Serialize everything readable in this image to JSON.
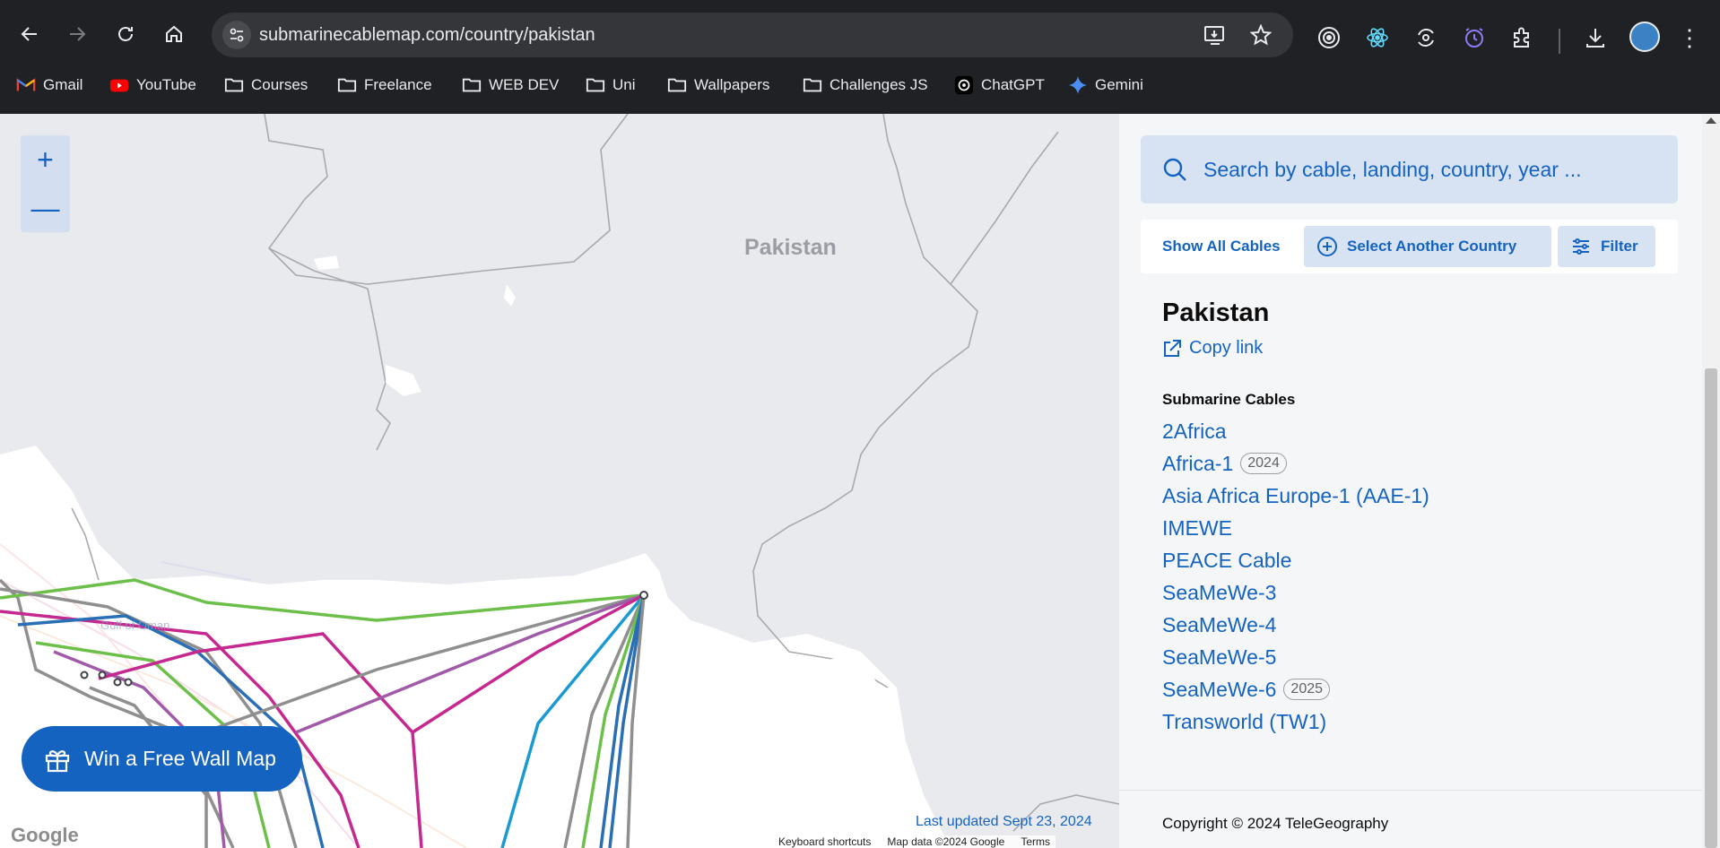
{
  "browser": {
    "url": "submarinecablemap.com/country/pakistan",
    "bookmarks": [
      {
        "label": "Gmail",
        "icon": "gmail-icon"
      },
      {
        "label": "YouTube",
        "icon": "youtube-icon"
      },
      {
        "label": "Courses",
        "icon": "folder-icon"
      },
      {
        "label": "Freelance",
        "icon": "folder-icon"
      },
      {
        "label": "WEB DEV",
        "icon": "folder-icon"
      },
      {
        "label": "Uni",
        "icon": "folder-icon"
      },
      {
        "label": "Wallpapers",
        "icon": "folder-icon"
      },
      {
        "label": "Challenges JS",
        "icon": "folder-icon"
      },
      {
        "label": "ChatGPT",
        "icon": "chatgpt-icon"
      },
      {
        "label": "Gemini",
        "icon": "gemini-icon"
      }
    ]
  },
  "map": {
    "zoom_in": "+",
    "zoom_out": "—",
    "country_label": "Pakistan",
    "win_button": "Win a Free Wall Map",
    "google_logo": "Google",
    "last_updated": "Last updated Sept 23, 2024",
    "attribution": [
      "Keyboard shortcuts",
      "Map data ©2024 Google",
      "Terms"
    ],
    "gulf_label": "Gulf of Oman",
    "colors": {
      "accent": "#1563c1",
      "green": "#6cc04a",
      "magenta": "#c5288e",
      "blue": "#2a6fb5",
      "gray": "#8f8f8f",
      "cyan": "#1b9ad2"
    }
  },
  "panel": {
    "search_placeholder": "Search by cable, landing, country, year ...",
    "show_all": "Show All Cables",
    "select_country": "Select Another Country",
    "filter": "Filter",
    "country_title": "Pakistan",
    "copy_link": "Copy link",
    "section_heading": "Submarine Cables",
    "cables": [
      {
        "name": "2Africa",
        "year": ""
      },
      {
        "name": "Africa-1",
        "year": "2024"
      },
      {
        "name": "Asia Africa Europe-1 (AAE-1)",
        "year": ""
      },
      {
        "name": "IMEWE",
        "year": ""
      },
      {
        "name": "PEACE Cable",
        "year": ""
      },
      {
        "name": "SeaMeWe-3",
        "year": ""
      },
      {
        "name": "SeaMeWe-4",
        "year": ""
      },
      {
        "name": "SeaMeWe-5",
        "year": ""
      },
      {
        "name": "SeaMeWe-6",
        "year": "2025"
      },
      {
        "name": "Transworld (TW1)",
        "year": ""
      }
    ],
    "copyright": "Copyright © 2024 TeleGeography"
  }
}
